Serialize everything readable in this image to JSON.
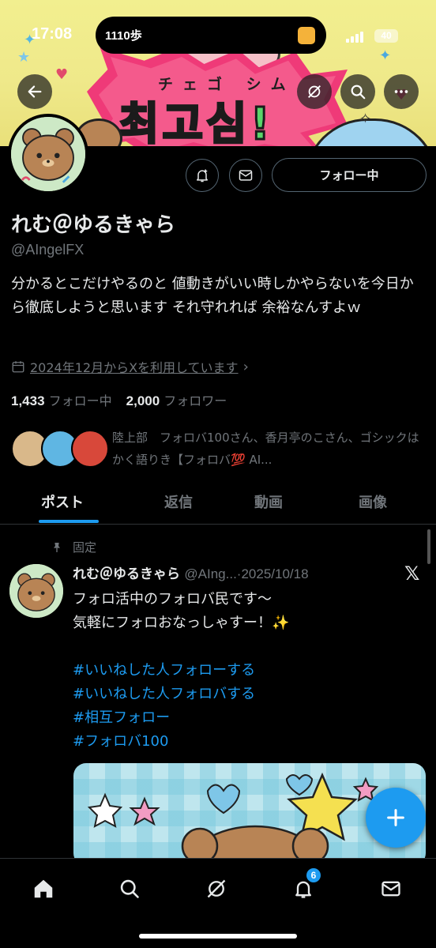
{
  "status_bar": {
    "time": "17:08",
    "steps": "1110歩",
    "battery": "40"
  },
  "banner": {
    "ruby_text": "チェゴ シム",
    "big_text": "최고심!"
  },
  "profile": {
    "follow_button_label": "フォロー中",
    "name": "れむ＠ゆるきゃら",
    "handle": "@AIngelFX",
    "bio": "分かるとこだけやるのと 値動きがいい時しかやらないを今日から徹底しようと思います それ守れれば 余裕なんすよｗ",
    "joined": "2024年12月からXを利用しています",
    "following_count": "1,433",
    "following_label": "フォロー中",
    "followers_count": "2,000",
    "followers_label": "フォロワー",
    "known_followers_text": "陸上部　フォロバ100さん、香月亭のこさん、ゴシックはかく語りき【フォロバ💯 AI..."
  },
  "tabs": [
    {
      "label": "ポスト",
      "active": true
    },
    {
      "label": "返信",
      "active": false
    },
    {
      "label": "動画",
      "active": false
    },
    {
      "label": "画像",
      "active": false
    }
  ],
  "post": {
    "pinned_label": "固定",
    "author_name": "れむ＠ゆるきゃら",
    "author_handle_date": "@AIng...·2025/10/18",
    "text_line1": "フォロ活中のフォロバ民です〜",
    "text_line2": "気軽にフォロおなっしゃすー！✨",
    "hashtags": [
      "#いいねした人フォローする",
      "#いいねした人フォロバする",
      "#相互フォロー",
      "#フォロバ100"
    ]
  },
  "bottom_nav": {
    "notifications_badge": "6"
  },
  "colors": {
    "background": "#000000",
    "accent": "#1d9bf0",
    "secondary_text": "#71767b",
    "border": "#2f3336"
  }
}
